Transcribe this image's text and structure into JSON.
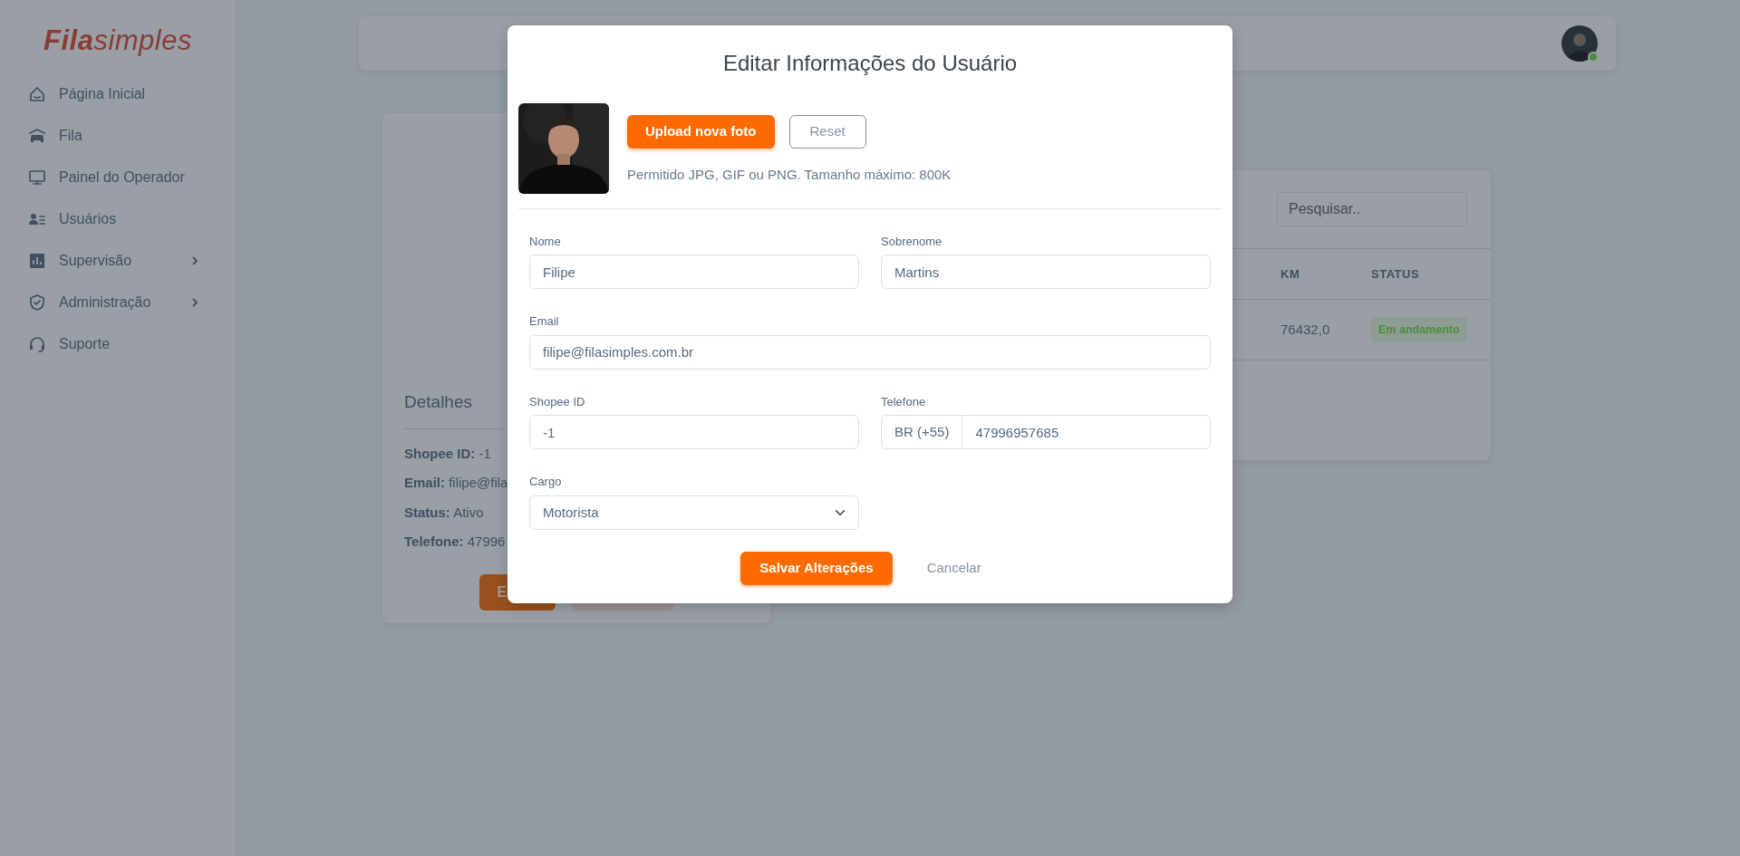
{
  "sidebar": {
    "logo": "**Fila**simples",
    "items": [
      {
        "label": "Página Inicial",
        "kind": "link"
      },
      {
        "label": "Fila",
        "kind": "link"
      },
      {
        "label": "Painel do Operador",
        "kind": "link"
      },
      {
        "label": "Usuários",
        "kind": "link"
      },
      {
        "label": "Supervisão",
        "kind": "submenu"
      },
      {
        "label": "Administração",
        "kind": "submenu"
      },
      {
        "label": "Suporte",
        "kind": "link"
      }
    ]
  },
  "header": {
    "avatar": {
      "online": true
    }
  },
  "details_card": {
    "title": "Detalhes",
    "lines": [
      "**Shopee ID:** -1",
      "**Email:** filipe@fila",
      "**Status:** Ativo",
      "**Telefone:** 47996"
    ],
    "edit_button": "E"
  },
  "table_card": {
    "search": {
      "placeholder": "Pesquisar.."
    },
    "columns": [
      "KM",
      "STATUS"
    ],
    "rows": [
      {
        "km": "76432,0",
        "status": "Em andamento"
      }
    ]
  },
  "modal": {
    "title": "Editar Informações do Usuário",
    "upload_button": "Upload nova foto",
    "reset_button": "Reset",
    "help": "Permitido JPG, GIF ou PNG. Tamanho máximo: 800K",
    "fields": [
      {
        "label": "Nome",
        "value": "Filipe",
        "kind": "text"
      },
      {
        "label": "Sobrenome",
        "value": "Martins",
        "kind": "text"
      },
      {
        "label": "Email",
        "value": "filipe@filasimples.com.br",
        "kind": "wide"
      },
      {
        "label": "Shopee ID",
        "value": "-1",
        "kind": "text"
      },
      {
        "label": "Telefone",
        "prefix": "BR (+55)",
        "value": "47996957685",
        "kind": "phone"
      },
      {
        "label": "Cargo",
        "value": "Motorista",
        "kind": "select"
      }
    ],
    "save_button": "Salvar Alterações",
    "cancel_button": "Cancelar"
  }
}
